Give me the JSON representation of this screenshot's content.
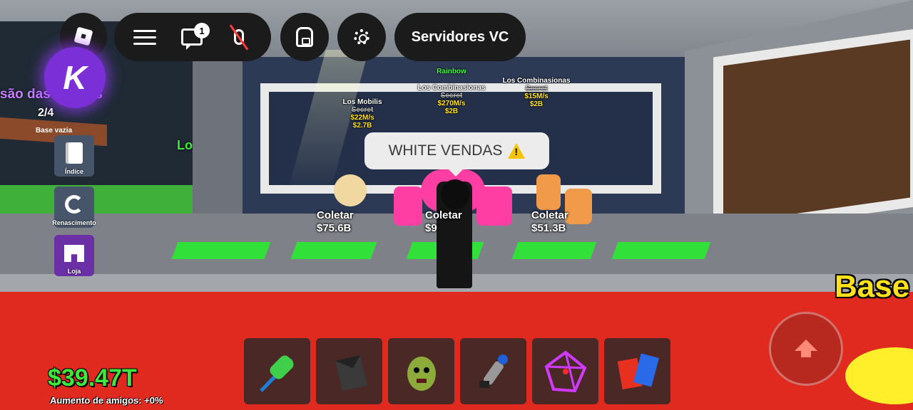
{
  "top_bar": {
    "chat_badge_count": "1",
    "servers_label": "Servidores VC"
  },
  "side_menu": {
    "indice_label": "Índice",
    "renascimento_label": "Renascimento",
    "loja_label": "Loja"
  },
  "world": {
    "left_caption": "são das",
    "left_caption_tail": "as",
    "left_count": "2/4",
    "left_sign": "Base vazia",
    "loja_sign": "Loja",
    "base_text": "Base",
    "notice": "WHITE VENDAS"
  },
  "brainrots": [
    {
      "name": "Los Mobilis",
      "rate": "$22M/s",
      "value": "$2.7B",
      "strike": "Secret"
    },
    {
      "rainbow": "Rainbow",
      "name": "Los Combinasionas",
      "rate": "$270M/s",
      "value": "$2B",
      "strike": "Secret"
    },
    {
      "name": "Los Combinasionas",
      "rate": "$15M/s",
      "value": "$2B",
      "strike": "Secret"
    }
  ],
  "collect_pads": [
    {
      "label": "Coletar",
      "amount": "$75.6B"
    },
    {
      "label": "Coletar",
      "amount": "$9"
    },
    {
      "label": "Coletar",
      "amount": "$51.3B"
    }
  ],
  "hud": {
    "money": "$39.47T",
    "friends_boost": "Aumento de amigos: +0%"
  },
  "hotbar": [
    {
      "icon": "green-bone-staff-icon"
    },
    {
      "icon": "black-cloak-icon"
    },
    {
      "icon": "zombie-mask-icon"
    },
    {
      "icon": "grapple-gun-icon"
    },
    {
      "icon": "purple-cage-icon"
    },
    {
      "icon": "red-blue-hammer-icon"
    }
  ],
  "colors": {
    "money_green": "#3ee83e",
    "loja_purple": "#6b2fa6",
    "red_floor": "#e0291f",
    "base_yellow": "#ffe21a"
  }
}
